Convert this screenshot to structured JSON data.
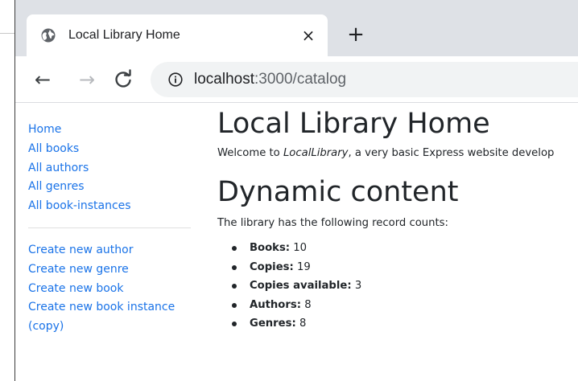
{
  "browser": {
    "tab_title": "Local Library Home",
    "tab_close_glyph": "×",
    "new_tab_glyph": "+",
    "back_glyph": "←",
    "forward_glyph": "→",
    "reload_glyph": "C",
    "url_host": "localhost",
    "url_path": ":3000/catalog"
  },
  "sidebar": {
    "primary": [
      {
        "label": "Home"
      },
      {
        "label": "All books"
      },
      {
        "label": "All authors"
      },
      {
        "label": "All genres"
      },
      {
        "label": "All book-instances"
      }
    ],
    "secondary": [
      {
        "label": "Create new author"
      },
      {
        "label": "Create new genre"
      },
      {
        "label": "Create new book"
      },
      {
        "label": "Create new book instance"
      },
      {
        "label": "(copy)"
      }
    ]
  },
  "main": {
    "title": "Local Library Home",
    "intro_before": "Welcome to ",
    "intro_em": "LocalLibrary",
    "intro_after": ", a very basic Express website develop",
    "section_title": "Dynamic content",
    "counts_lead": "The library has the following record counts:",
    "counts": [
      {
        "label": "Books:",
        "value": "10"
      },
      {
        "label": "Copies:",
        "value": "19"
      },
      {
        "label": "Copies available:",
        "value": "3"
      },
      {
        "label": "Authors:",
        "value": "8"
      },
      {
        "label": "Genres:",
        "value": "8"
      }
    ]
  },
  "colors": {
    "link": "#1a73e8",
    "tabstrip": "#dee1e6",
    "text": "#212529"
  }
}
